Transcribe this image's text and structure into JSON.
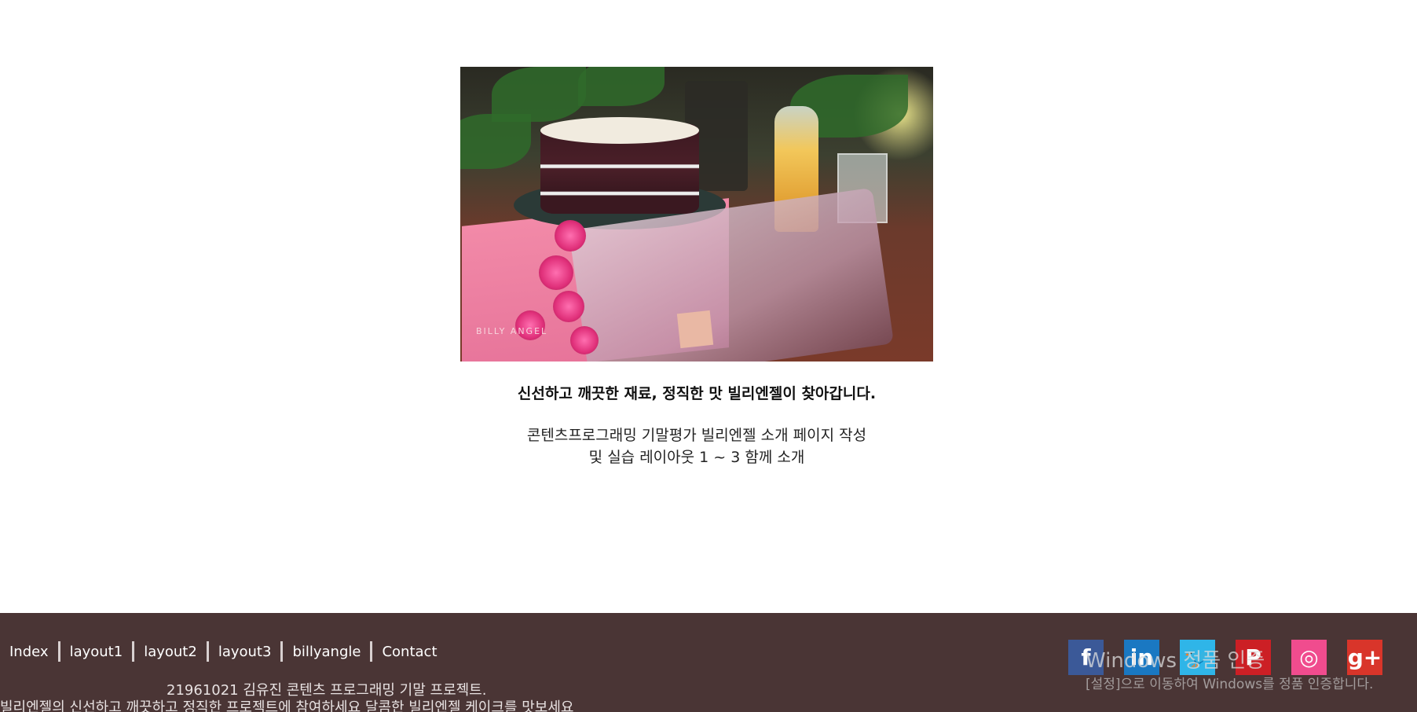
{
  "hero": {
    "packaging_text": "BILLY ANGEL"
  },
  "main": {
    "tagline": "신선하고 깨끗한 재료, 정직한 맛 빌리엔젤이 찾아갑니다.",
    "desc_line1": "콘텐츠프로그래밍 기말평가 빌리엔젤 소개 페이지 작성",
    "desc_line2": "및 실습 레이아웃 1 ~ 3 함께 소개"
  },
  "footer": {
    "nav": [
      "Index",
      "layout1",
      "layout2",
      "layout3",
      "billyangle",
      "Contact"
    ],
    "copyright": "21961021 김유진 콘텐츠 프로그래밍 기말 프로젝트.",
    "slogan": "빌리엔젤의 신선하고 깨끗하고 정직한 프로젝트에 참여하세요 달콤한 빌리엔젤 케이크를 맛보세요",
    "background": "#4a3535",
    "social": [
      {
        "name": "facebook-icon",
        "glyph": "f",
        "color": "#3b5998"
      },
      {
        "name": "linkedin-icon",
        "glyph": "in",
        "color": "#1a78c2"
      },
      {
        "name": "twitter-icon",
        "glyph": "🐦",
        "color": "#2fb5e8"
      },
      {
        "name": "pinterest-icon",
        "glyph": "P",
        "color": "#cc1f25"
      },
      {
        "name": "dribbble-icon",
        "glyph": "◎",
        "color": "#f04c8e"
      },
      {
        "name": "google-plus-icon",
        "glyph": "g+",
        "color": "#d9352a"
      }
    ]
  },
  "windows_watermark": {
    "line1": "Windows 정품 인증",
    "line2": "[설정]으로 이동하여 Windows를 정품 인증합니다."
  }
}
